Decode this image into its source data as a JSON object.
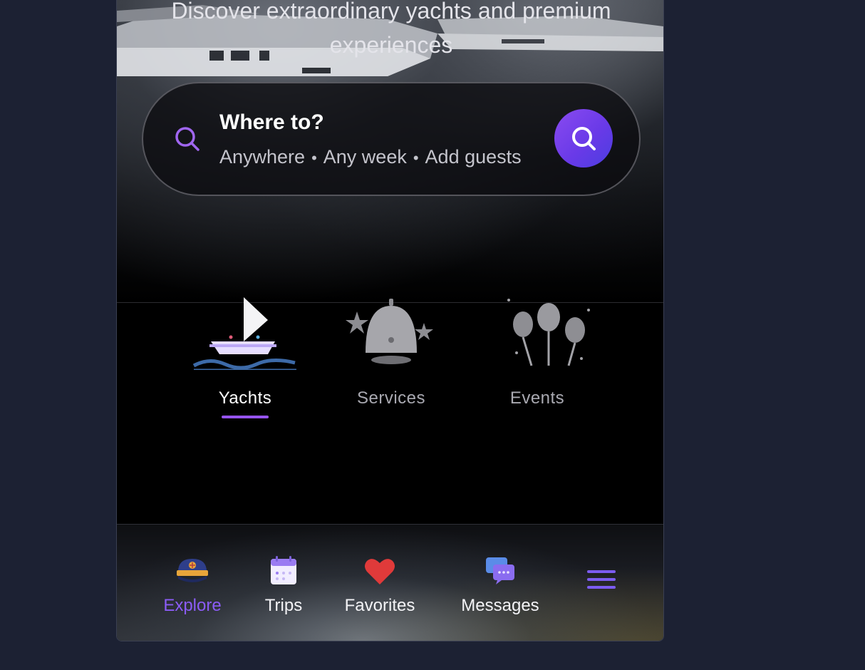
{
  "hero": {
    "tagline": "Discover extraordinary yachts and premium experiences"
  },
  "search": {
    "title": "Where to?",
    "where": "Anywhere",
    "when": "Any week",
    "guests": "Add guests",
    "separator": "•"
  },
  "categories": [
    {
      "label": "Yachts",
      "icon": "sailboat-icon",
      "active": true
    },
    {
      "label": "Services",
      "icon": "service-bell-icon",
      "active": false
    },
    {
      "label": "Events",
      "icon": "balloons-icon",
      "active": false
    }
  ],
  "nav": {
    "items": [
      {
        "label": "Explore",
        "icon": "captain-hat-icon",
        "active": true
      },
      {
        "label": "Trips",
        "icon": "calendar-icon",
        "active": false
      },
      {
        "label": "Favorites",
        "icon": "heart-icon",
        "active": false
      },
      {
        "label": "Messages",
        "icon": "chat-bubbles-icon",
        "active": false
      }
    ],
    "menu_icon": "hamburger-menu-icon"
  },
  "colors": {
    "accent": "#8b5cf6",
    "background": "#1c2133",
    "search_button": "#6a3ae8"
  }
}
